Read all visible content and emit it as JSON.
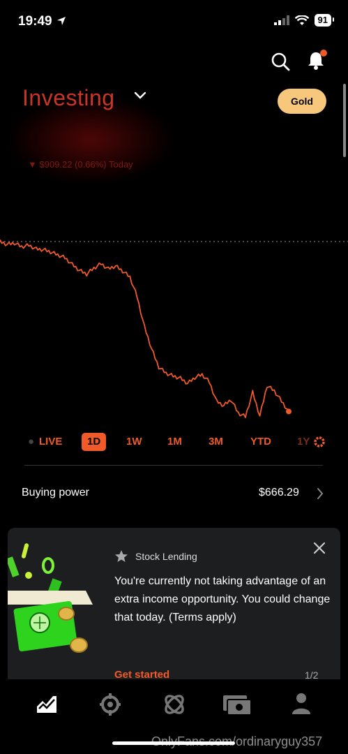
{
  "status": {
    "time": "19:49",
    "battery": "91"
  },
  "header": {
    "title": "Investing",
    "gold_label": "Gold",
    "change_text": "$909.22 (0.66%) Today"
  },
  "chart_data": {
    "type": "line",
    "title": "",
    "series": [
      {
        "values": [
          100,
          99.6,
          99.8,
          99.3,
          99.5,
          99.0,
          98.9,
          98.6,
          98.2,
          97.8,
          96.9,
          96.1,
          95.6,
          96.4,
          97.0,
          96.3,
          96.7,
          96.0,
          95.2,
          92.5,
          88.5,
          85.5,
          83.0,
          82.2,
          81.8,
          81.5,
          80.8,
          81.6,
          82.0,
          81.0,
          78.4,
          77.8,
          78.6,
          76.8,
          76.3,
          79.6,
          76.4,
          80.5,
          79.8,
          78.4,
          77.0
        ]
      }
    ],
    "reference_line": "previous close",
    "color": "#f05a28"
  },
  "timeframes": {
    "live": "LIVE",
    "d1": "1D",
    "w1": "1W",
    "m1": "1M",
    "m3": "3M",
    "ytd": "YTD",
    "y1": "1Y",
    "selected": "1D"
  },
  "buying_power": {
    "label": "Buying power",
    "value": "$666.29"
  },
  "card": {
    "title": "Stock Lending",
    "body": "You're currently not taking advantage of an extra income opportunity. You could change that today. (Terms apply)",
    "cta": "Get started",
    "pager": "1/2"
  },
  "tabs": [
    "investing-tab-icon",
    "crypto-tab-icon",
    "network-tab-icon",
    "cash-tab-icon",
    "account-tab-icon"
  ],
  "watermark": "OnlyFans.com/ordinaryguy357",
  "accent": "#f05a28"
}
